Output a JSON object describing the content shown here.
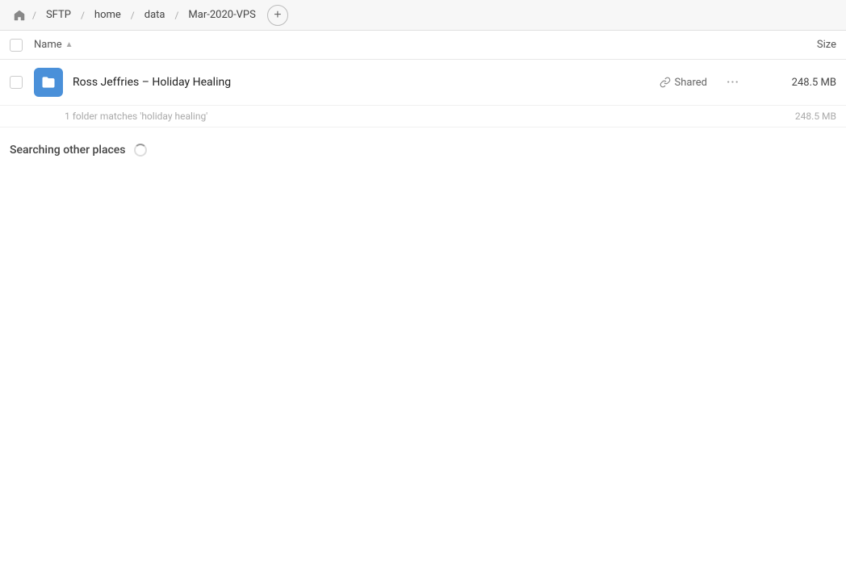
{
  "breadcrumb": {
    "home_icon": "🏠",
    "items": [
      {
        "label": "SFTP",
        "id": "sftp"
      },
      {
        "label": "home",
        "id": "home"
      },
      {
        "label": "data",
        "id": "data"
      },
      {
        "label": "Mar-2020-VPS",
        "id": "mar-2020-vps"
      }
    ],
    "add_icon": "+"
  },
  "columns": {
    "name_label": "Name",
    "sort_icon": "▲",
    "size_label": "Size"
  },
  "file_row": {
    "name": "Ross Jeffries – Holiday Healing",
    "shared_label": "Shared",
    "size": "248.5 MB",
    "more_icon": "···"
  },
  "match_info": {
    "text": "1 folder matches 'holiday healing'",
    "size": "248.5 MB"
  },
  "searching": {
    "label": "Searching other places"
  }
}
